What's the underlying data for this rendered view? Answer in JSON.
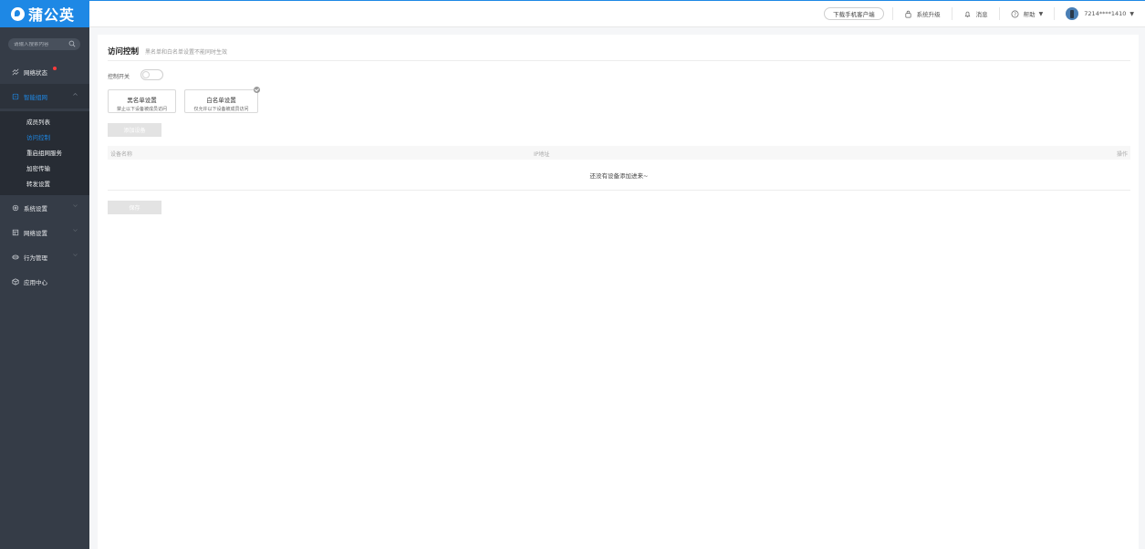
{
  "brand": {
    "name": "蒲公英",
    "accent_color": "#1e88e5"
  },
  "header": {
    "download_label": "下载手机客户端",
    "upgrade_label": "系统升级",
    "messages_label": "消息",
    "help_label": "帮助",
    "account_label": "7214****1410",
    "icons": [
      "upgrade-icon",
      "bell-icon",
      "help-icon",
      "avatar"
    ]
  },
  "sidebar": {
    "search_placeholder": "请输入搜索内容",
    "items": [
      {
        "label": "网络状态",
        "icon": "network-status-icon",
        "has_badge": true
      },
      {
        "label": "智能组网",
        "icon": "networking-icon",
        "active": true,
        "expanded": true
      },
      {
        "label": "系统设置",
        "icon": "gear-icon"
      },
      {
        "label": "网络设置",
        "icon": "network-settings-icon"
      },
      {
        "label": "行为管理",
        "icon": "behavior-icon"
      },
      {
        "label": "应用中心",
        "icon": "app-center-icon"
      }
    ],
    "submenu": [
      {
        "label": "成员列表"
      },
      {
        "label": "访问控制",
        "active": true
      },
      {
        "label": "重启组网服务"
      },
      {
        "label": "加密传输"
      },
      {
        "label": "转发设置"
      }
    ]
  },
  "main": {
    "title": "访问控制",
    "subtitle": "黑名单和白名单设置不能同时生效",
    "switch_label": "控制开关",
    "switch_on": false,
    "blacklist": {
      "title": "黑名单设置",
      "desc": "禁止以下设备被成员访问"
    },
    "whitelist": {
      "title": "白名单设置",
      "desc": "仅允许以下设备被成员访问",
      "selected": true
    },
    "add_device_label": "添加设备",
    "table": {
      "columns": [
        "设备名称",
        "IP地址",
        "操作"
      ],
      "empty_text": "还没有设备添加进来~"
    },
    "save_label": "保存"
  }
}
